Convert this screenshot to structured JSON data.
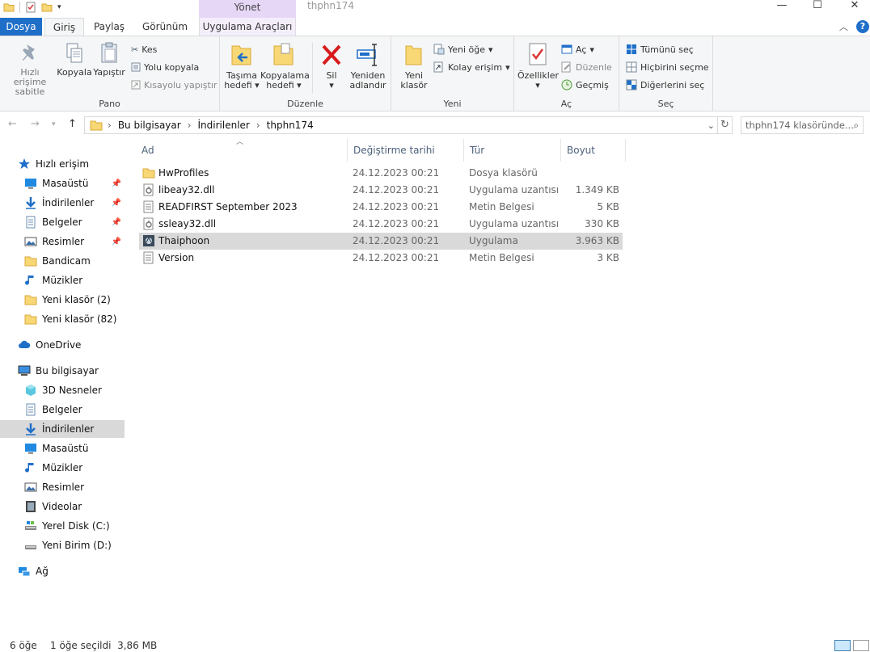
{
  "window": {
    "title": "thphn174",
    "context_tab_group": "Yönet"
  },
  "tabs": {
    "file": "Dosya",
    "home": "Giriş",
    "share": "Paylaş",
    "view": "Görünüm",
    "app_tools": "Uygulama Araçları"
  },
  "ribbon": {
    "clipboard": {
      "label": "Pano",
      "pin": "Hızlı erişime sabitle",
      "copy": "Kopyala",
      "paste": "Yapıştır",
      "cut": "Kes",
      "copy_path": "Yolu kopyala",
      "paste_shortcut": "Kısayolu yapıştır"
    },
    "organize": {
      "label": "Düzenle",
      "move_to": "Taşıma hedefi",
      "copy_to": "Kopyalama hedefi",
      "delete": "Sil",
      "rename": "Yeniden adlandır"
    },
    "new": {
      "label": "Yeni",
      "new_folder": "Yeni klasör",
      "new_item": "Yeni öğe",
      "easy_access": "Kolay erişim"
    },
    "open": {
      "label": "Aç",
      "properties": "Özellikler",
      "open": "Aç",
      "edit": "Düzenle",
      "history": "Geçmiş"
    },
    "select": {
      "label": "Seç",
      "select_all": "Tümünü seç",
      "select_none": "Hiçbirini seçme",
      "invert": "Diğerlerini seç"
    }
  },
  "address": {
    "crumbs": [
      "Bu bilgisayar",
      "İndirilenler",
      "thphn174"
    ],
    "search_placeholder": "thphn174 klasöründe..."
  },
  "navpane": {
    "quick_access": "Hızlı erişim",
    "quick_items": [
      "Masaüstü",
      "İndirilenler",
      "Belgeler",
      "Resimler",
      "Bandicam",
      "Müzikler",
      "Yeni klasör (2)",
      "Yeni klasör (82)"
    ],
    "onedrive": "OneDrive",
    "this_pc": "Bu bilgisayar",
    "pc_items": [
      "3D Nesneler",
      "Belgeler",
      "İndirilenler",
      "Masaüstü",
      "Müzikler",
      "Resimler",
      "Videolar",
      "Yerel Disk (C:)",
      "Yeni Birim (D:)"
    ],
    "network": "Ağ"
  },
  "columns": {
    "name": "Ad",
    "date": "Değiştirme tarihi",
    "type": "Tür",
    "size": "Boyut"
  },
  "files": [
    {
      "name": "HwProfiles",
      "date": "24.12.2023 00:21",
      "type": "Dosya klasörü",
      "size": "",
      "icon": "folder"
    },
    {
      "name": "libeay32.dll",
      "date": "24.12.2023 00:21",
      "type": "Uygulama uzantısı",
      "size": "1.349 KB",
      "icon": "dll"
    },
    {
      "name": "READFIRST September 2023",
      "date": "24.12.2023 00:21",
      "type": "Metin Belgesi",
      "size": "5 KB",
      "icon": "text"
    },
    {
      "name": "ssleay32.dll",
      "date": "24.12.2023 00:21",
      "type": "Uygulama uzantısı",
      "size": "330 KB",
      "icon": "dll"
    },
    {
      "name": "Thaiphoon",
      "date": "24.12.2023 00:21",
      "type": "Uygulama",
      "size": "3.963 KB",
      "icon": "app"
    },
    {
      "name": "Version",
      "date": "24.12.2023 00:21",
      "type": "Metin Belgesi",
      "size": "3 KB",
      "icon": "text"
    }
  ],
  "status": {
    "count": "6 öğe",
    "selected": "1 öğe seçildi  3,86 MB"
  },
  "colors": {
    "accent": "#1f6fc8",
    "context": "#e7d7f7",
    "selection": "#d9d9d9"
  }
}
